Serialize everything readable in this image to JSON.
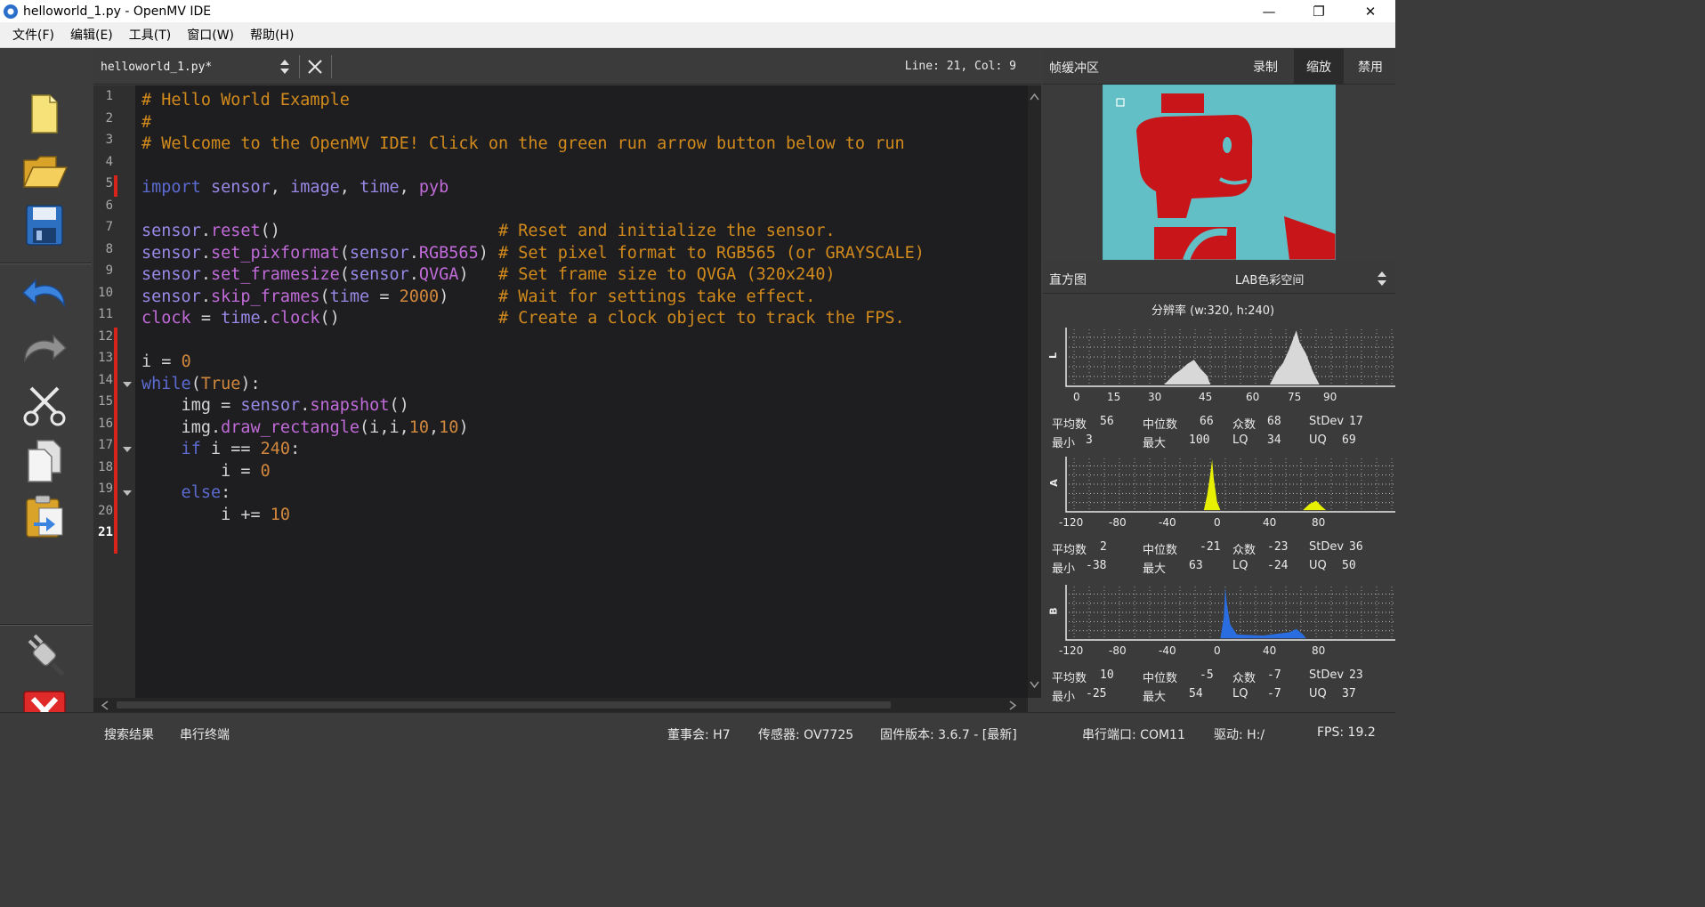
{
  "window": {
    "title": "helloworld_1.py - OpenMV IDE",
    "minimize": "—",
    "maximize": "❐",
    "close": "✕"
  },
  "menu": [
    "文件(F)",
    "编辑(E)",
    "工具(T)",
    "窗口(W)",
    "帮助(H)"
  ],
  "toolbar_icons": [
    "new-file-icon",
    "open-folder-icon",
    "save-icon",
    "undo-icon",
    "redo-icon",
    "cut-icon",
    "copy-icon",
    "paste-icon",
    "connect-icon",
    "stop-icon"
  ],
  "editor": {
    "tab_name": "helloworld_1.py*",
    "line_col": "Line: 21, Col: 9",
    "line_numbers": [
      "1",
      "2",
      "3",
      "4",
      "5",
      "6",
      "7",
      "8",
      "9",
      "10",
      "11",
      "12",
      "13",
      "14",
      "15",
      "16",
      "17",
      "18",
      "19",
      "20",
      "21"
    ],
    "code": [
      [
        [
          "c-comment",
          "# Hello World Example"
        ]
      ],
      [
        [
          "c-comment",
          "#"
        ]
      ],
      [
        [
          "c-comment",
          "# Welcome to the OpenMV IDE! Click on the green run arrow button below to run"
        ]
      ],
      [],
      [
        [
          "c-kw",
          "import"
        ],
        [
          "c-plain",
          " "
        ],
        [
          "c-mod",
          "sensor"
        ],
        [
          "c-plain",
          ", "
        ],
        [
          "c-mod",
          "image"
        ],
        [
          "c-plain",
          ", "
        ],
        [
          "c-mod",
          "time"
        ],
        [
          "c-plain",
          ", "
        ],
        [
          "c-mem",
          "pyb"
        ]
      ],
      [],
      [
        [
          "c-mod",
          "sensor"
        ],
        [
          "c-plain",
          "."
        ],
        [
          "c-mem",
          "reset"
        ],
        [
          "c-plain",
          "()                      "
        ],
        [
          "c-comment",
          "# Reset and initialize the sensor."
        ]
      ],
      [
        [
          "c-mod",
          "sensor"
        ],
        [
          "c-plain",
          "."
        ],
        [
          "c-mem",
          "set_pixformat"
        ],
        [
          "c-plain",
          "("
        ],
        [
          "c-mod",
          "sensor"
        ],
        [
          "c-plain",
          "."
        ],
        [
          "c-mem",
          "RGB565"
        ],
        [
          "c-plain",
          ") "
        ],
        [
          "c-comment",
          "# Set pixel format to RGB565 (or GRAYSCALE)"
        ]
      ],
      [
        [
          "c-mod",
          "sensor"
        ],
        [
          "c-plain",
          "."
        ],
        [
          "c-mem",
          "set_framesize"
        ],
        [
          "c-plain",
          "("
        ],
        [
          "c-mod",
          "sensor"
        ],
        [
          "c-plain",
          "."
        ],
        [
          "c-mem",
          "QVGA"
        ],
        [
          "c-plain",
          ")   "
        ],
        [
          "c-comment",
          "# Set frame size to QVGA (320x240)"
        ]
      ],
      [
        [
          "c-mod",
          "sensor"
        ],
        [
          "c-plain",
          "."
        ],
        [
          "c-mem",
          "skip_frames"
        ],
        [
          "c-plain",
          "("
        ],
        [
          "c-mod",
          "time"
        ],
        [
          "c-plain",
          " = "
        ],
        [
          "c-num",
          "2000"
        ],
        [
          "c-plain",
          ")     "
        ],
        [
          "c-comment",
          "# Wait for settings take effect."
        ]
      ],
      [
        [
          "c-mem",
          "clock"
        ],
        [
          "c-plain",
          " = "
        ],
        [
          "c-mod",
          "time"
        ],
        [
          "c-plain",
          "."
        ],
        [
          "c-mem",
          "clock"
        ],
        [
          "c-plain",
          "()                "
        ],
        [
          "c-comment",
          "# Create a clock object to track the FPS."
        ]
      ],
      [],
      [
        [
          "c-plain",
          "i = "
        ],
        [
          "c-num",
          "0"
        ]
      ],
      [
        [
          "c-kw",
          "while"
        ],
        [
          "c-plain",
          "("
        ],
        [
          "c-num",
          "True"
        ],
        [
          "c-plain",
          "):"
        ]
      ],
      [
        [
          "c-plain",
          "    img = "
        ],
        [
          "c-mod",
          "sensor"
        ],
        [
          "c-plain",
          "."
        ],
        [
          "c-mem",
          "snapshot"
        ],
        [
          "c-plain",
          "()"
        ]
      ],
      [
        [
          "c-plain",
          "    img."
        ],
        [
          "c-mem",
          "draw_rectangle"
        ],
        [
          "c-plain",
          "(i,i,"
        ],
        [
          "c-num",
          "10"
        ],
        [
          "c-plain",
          ","
        ],
        [
          "c-num",
          "10"
        ],
        [
          "c-plain",
          ")"
        ]
      ],
      [
        [
          "c-kw",
          "    if"
        ],
        [
          "c-plain",
          " i == "
        ],
        [
          "c-num",
          "240"
        ],
        [
          "c-plain",
          ":"
        ]
      ],
      [
        [
          "c-plain",
          "        i = "
        ],
        [
          "c-num",
          "0"
        ]
      ],
      [
        [
          "c-kw",
          "    else"
        ],
        [
          "c-plain",
          ":"
        ]
      ],
      [
        [
          "c-plain",
          "        i += "
        ],
        [
          "c-num",
          "10"
        ]
      ],
      []
    ]
  },
  "framebuffer": {
    "title": "帧缓冲区",
    "record": "录制",
    "zoom": "缩放",
    "disable": "禁用"
  },
  "histogram": {
    "title": "直方图",
    "colorspace": "LAB色彩空间",
    "resolution": "分辨率 (w:320, h:240)",
    "channels": [
      {
        "name": "L",
        "color": "#d8d8d8",
        "ticks": [
          "0",
          "15",
          "30",
          "45",
          "60",
          "75",
          "90"
        ],
        "stats": {
          "mean": "56",
          "median": "66",
          "mode": "68",
          "stdev": "17",
          "min": "3",
          "max": "100",
          "lq": "34",
          "uq": "69"
        }
      },
      {
        "name": "A",
        "color": "#e6f000",
        "ticks": [
          "-120",
          "-80",
          "-40",
          "0",
          "40",
          "80"
        ],
        "stats": {
          "mean": "2",
          "median": "-21",
          "mode": "-23",
          "stdev": "36",
          "min": "-38",
          "max": "63",
          "lq": "-24",
          "uq": "50"
        }
      },
      {
        "name": "B",
        "color": "#2a6de0",
        "ticks": [
          "-120",
          "-80",
          "-40",
          "0",
          "40",
          "80"
        ],
        "stats": {
          "mean": "10",
          "median": "-5",
          "mode": "-7",
          "stdev": "23",
          "min": "-25",
          "max": "54",
          "lq": "-7",
          "uq": "37"
        }
      }
    ],
    "labels": {
      "mean": "平均数",
      "median": "中位数",
      "mode": "众数",
      "stdev": "StDev",
      "min": "最小",
      "max": "最大",
      "lq": "LQ",
      "uq": "UQ"
    }
  },
  "status": {
    "search": "搜索结果",
    "serial_terminal": "串行终端",
    "board": "董事会: H7",
    "sensor": "传感器: OV7725",
    "firmware": "固件版本: 3.6.7 - [最新]",
    "port": "串行端口: COM11",
    "drive": "驱动: H:/",
    "fps": "FPS: 19.2"
  }
}
